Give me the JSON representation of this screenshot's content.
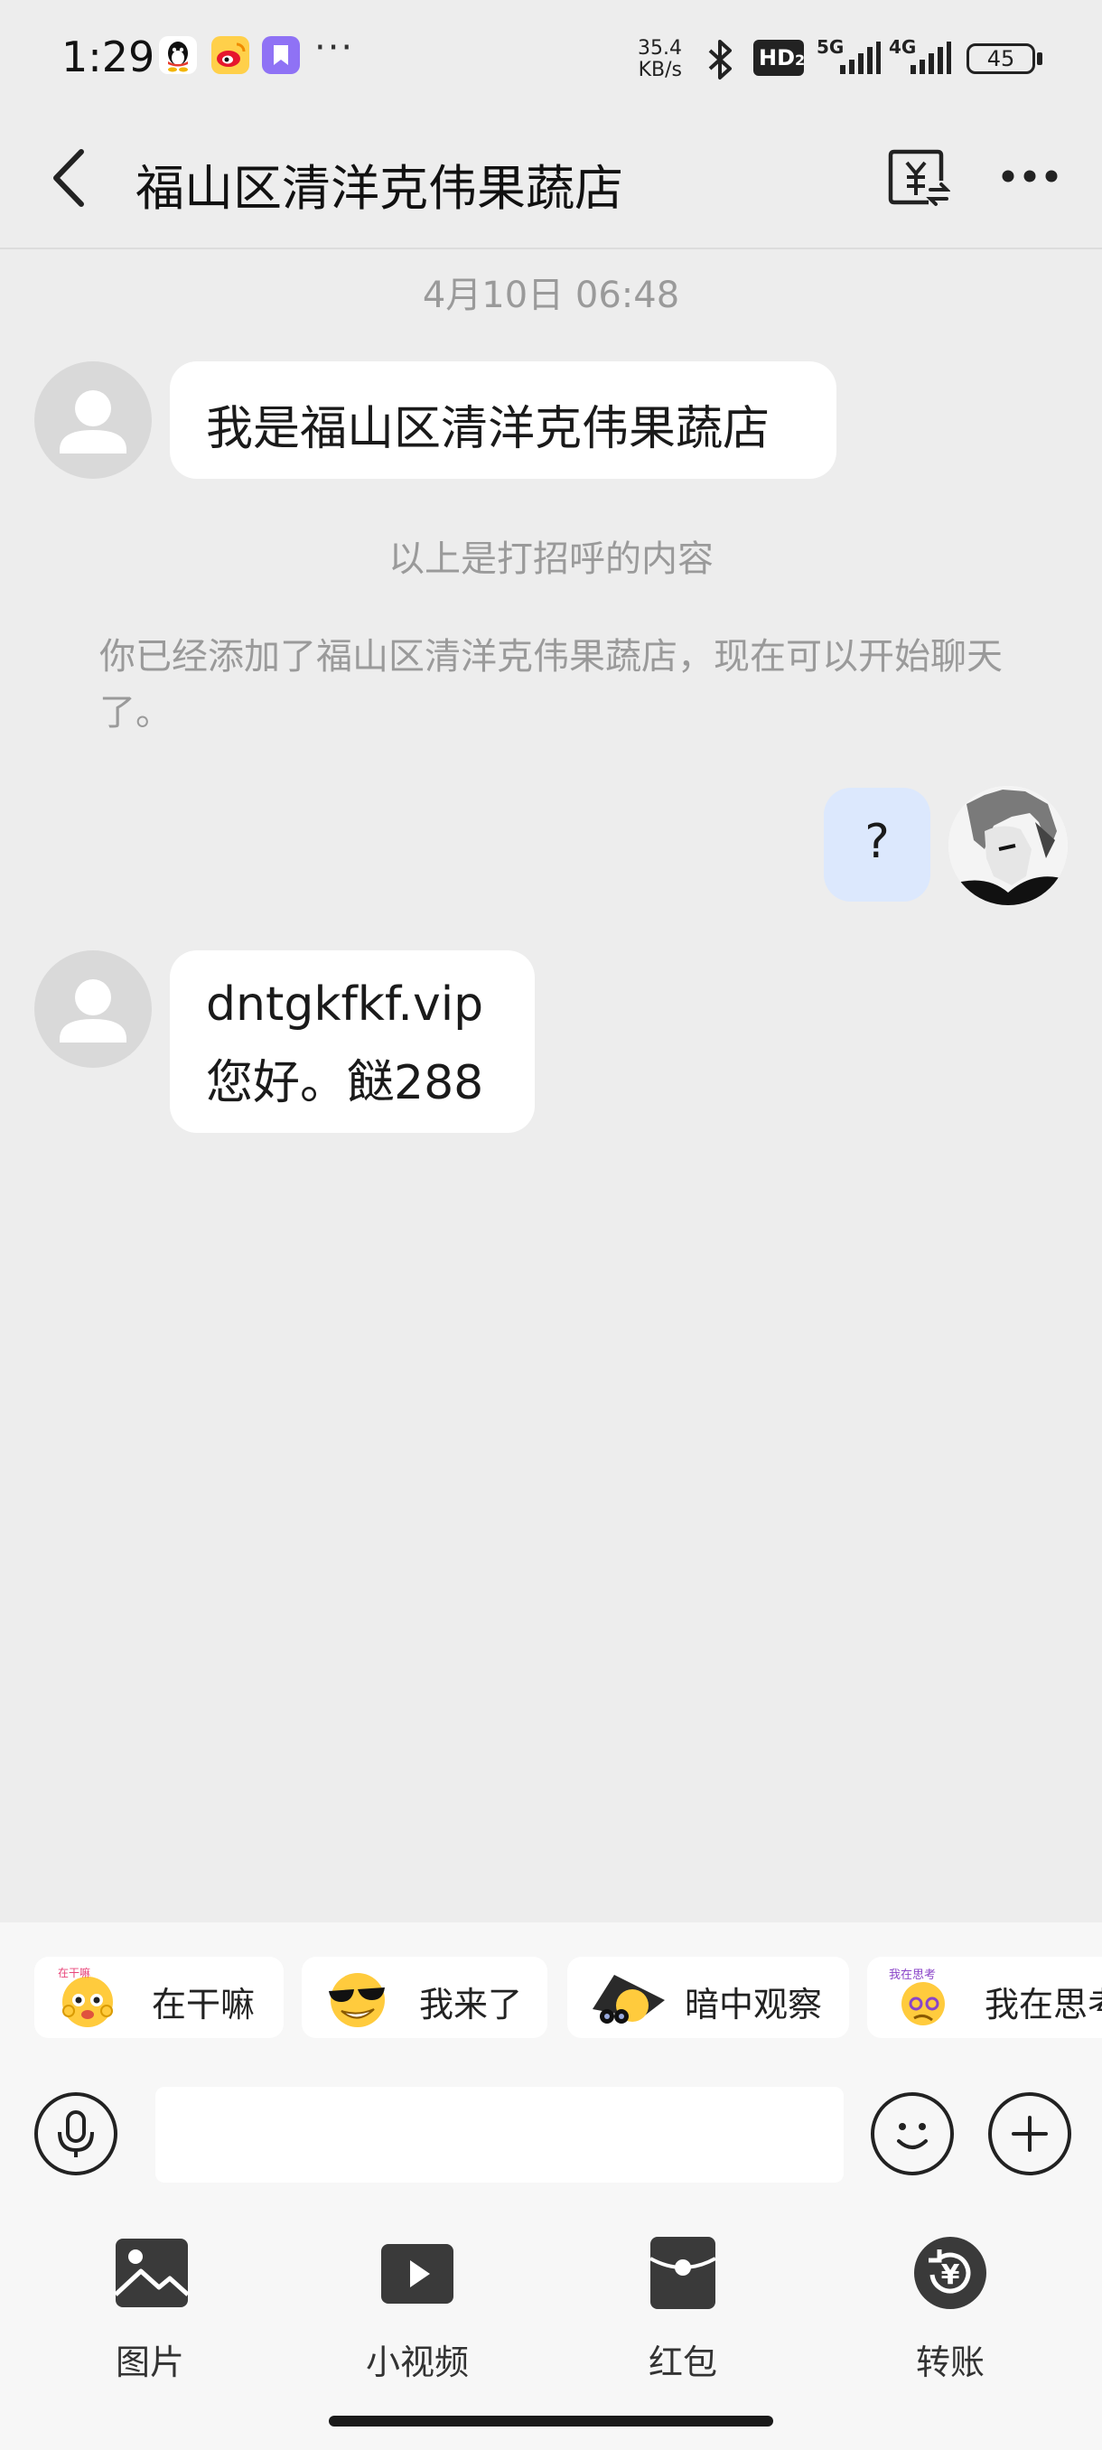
{
  "status_bar": {
    "time": "1:29",
    "net_speed_value": "35.4",
    "net_speed_unit": "KB/s",
    "hd_label": "HD",
    "hd_sub": "2",
    "sig1_label": "5G",
    "sig2_label": "4G",
    "battery": "45",
    "more_dots": "···",
    "app_icons": [
      "qq-icon",
      "weibo-icon",
      "bookmark-app-icon"
    ]
  },
  "header": {
    "title": "福山区清洋克伟果蔬店",
    "transfer_icon_glyph": "¥"
  },
  "chat": {
    "timestamp": "4月10日 06:48",
    "messages": [
      {
        "from": "contact",
        "lines": [
          "我是福山区清洋克伟果蔬店"
        ]
      },
      {
        "from": "me",
        "lines": [
          "?"
        ]
      },
      {
        "from": "contact",
        "lines": [
          "dntgkfkf.vip",
          "您好。餸288"
        ]
      }
    ],
    "greeting_note": "以上是打招呼的内容",
    "added_notice": "你已经添加了福山区清洋克伟果蔬店，现在可以开始聊天了。"
  },
  "stickers": [
    {
      "label": "在干嘛",
      "icon": "shy-emoji-icon",
      "badge": "在干嘛"
    },
    {
      "label": "我来了",
      "icon": "sunglasses-emoji-icon"
    },
    {
      "label": "暗中观察",
      "icon": "spy-emoji-icon"
    },
    {
      "label": "我在思考",
      "icon": "thinking-emoji-icon",
      "badge": "我在思考"
    }
  ],
  "input": {
    "placeholder": ""
  },
  "tools": [
    {
      "label": "图片",
      "icon": "image-icon"
    },
    {
      "label": "小视频",
      "icon": "video-icon"
    },
    {
      "label": "红包",
      "icon": "red-packet-icon"
    },
    {
      "label": "转账",
      "icon": "transfer-icon",
      "glyph": "¥"
    }
  ],
  "colors": {
    "background": "#ededed",
    "bubble_in": "#ffffff",
    "bubble_out": "#dce8fd",
    "system_text": "#9a9a9a"
  }
}
